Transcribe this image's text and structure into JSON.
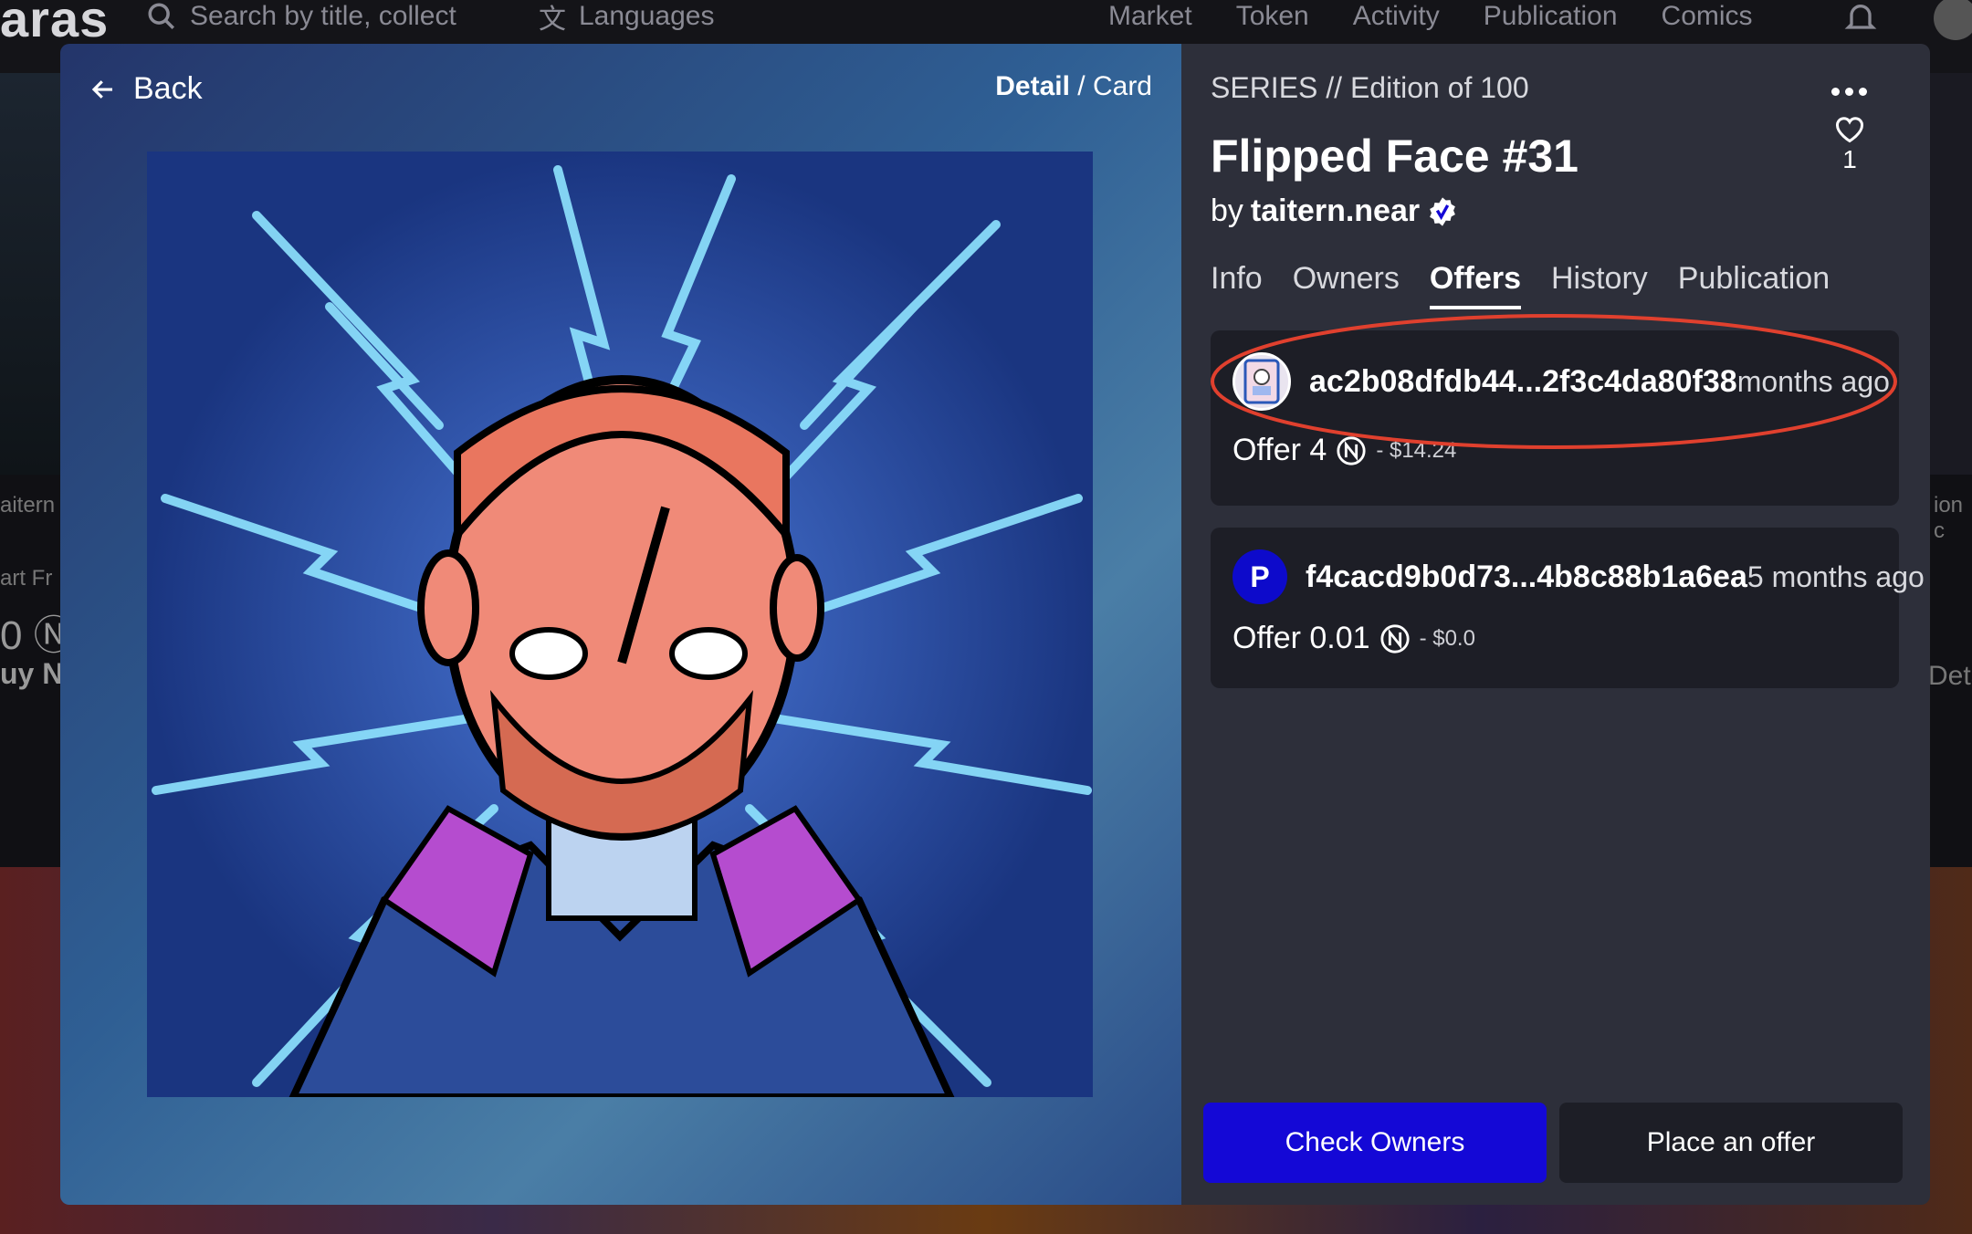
{
  "topnav": {
    "logo": "aras",
    "search_placeholder": "Search by title, collect",
    "languages": "Languages",
    "links": [
      "Market",
      "Token",
      "Activity",
      "Publication",
      "Comics"
    ]
  },
  "background": {
    "left_text_1": "aitern",
    "left_text_2": "art Fr",
    "left_text_3": "0 Ⓝ",
    "left_text_4": "uy N",
    "right_text_1": "ion c",
    "right_text_2": "Deta"
  },
  "modal": {
    "back_label": "Back",
    "view_detail": "Detail",
    "view_sep": " / ",
    "view_card": "Card",
    "series_label": "SERIES // Edition of 100",
    "title": "Flipped Face #31",
    "by_label": "by",
    "creator": "taitern.near",
    "likes": "1",
    "tabs": [
      "Info",
      "Owners",
      "Offers",
      "History",
      "Publication"
    ],
    "active_tab": "Offers",
    "offers": [
      {
        "address": "ac2b08dfdb44...2f3c4da80f38",
        "time": "months ago",
        "offer_label": "Offer 4",
        "usd": "- $14.24",
        "avatar_text": ""
      },
      {
        "address": "f4cacd9b0d73...4b8c88b1a6ea",
        "time": "5 months ago",
        "offer_label": "Offer 0.01",
        "usd": "- $0.0",
        "avatar_text": "P"
      }
    ],
    "check_owners_label": "Check Owners",
    "place_offer_label": "Place an offer"
  },
  "colors": {
    "primary_button": "#1408d6",
    "panel": "#2d2f3a",
    "card": "#1d1e26",
    "highlight": "#e0402e"
  }
}
